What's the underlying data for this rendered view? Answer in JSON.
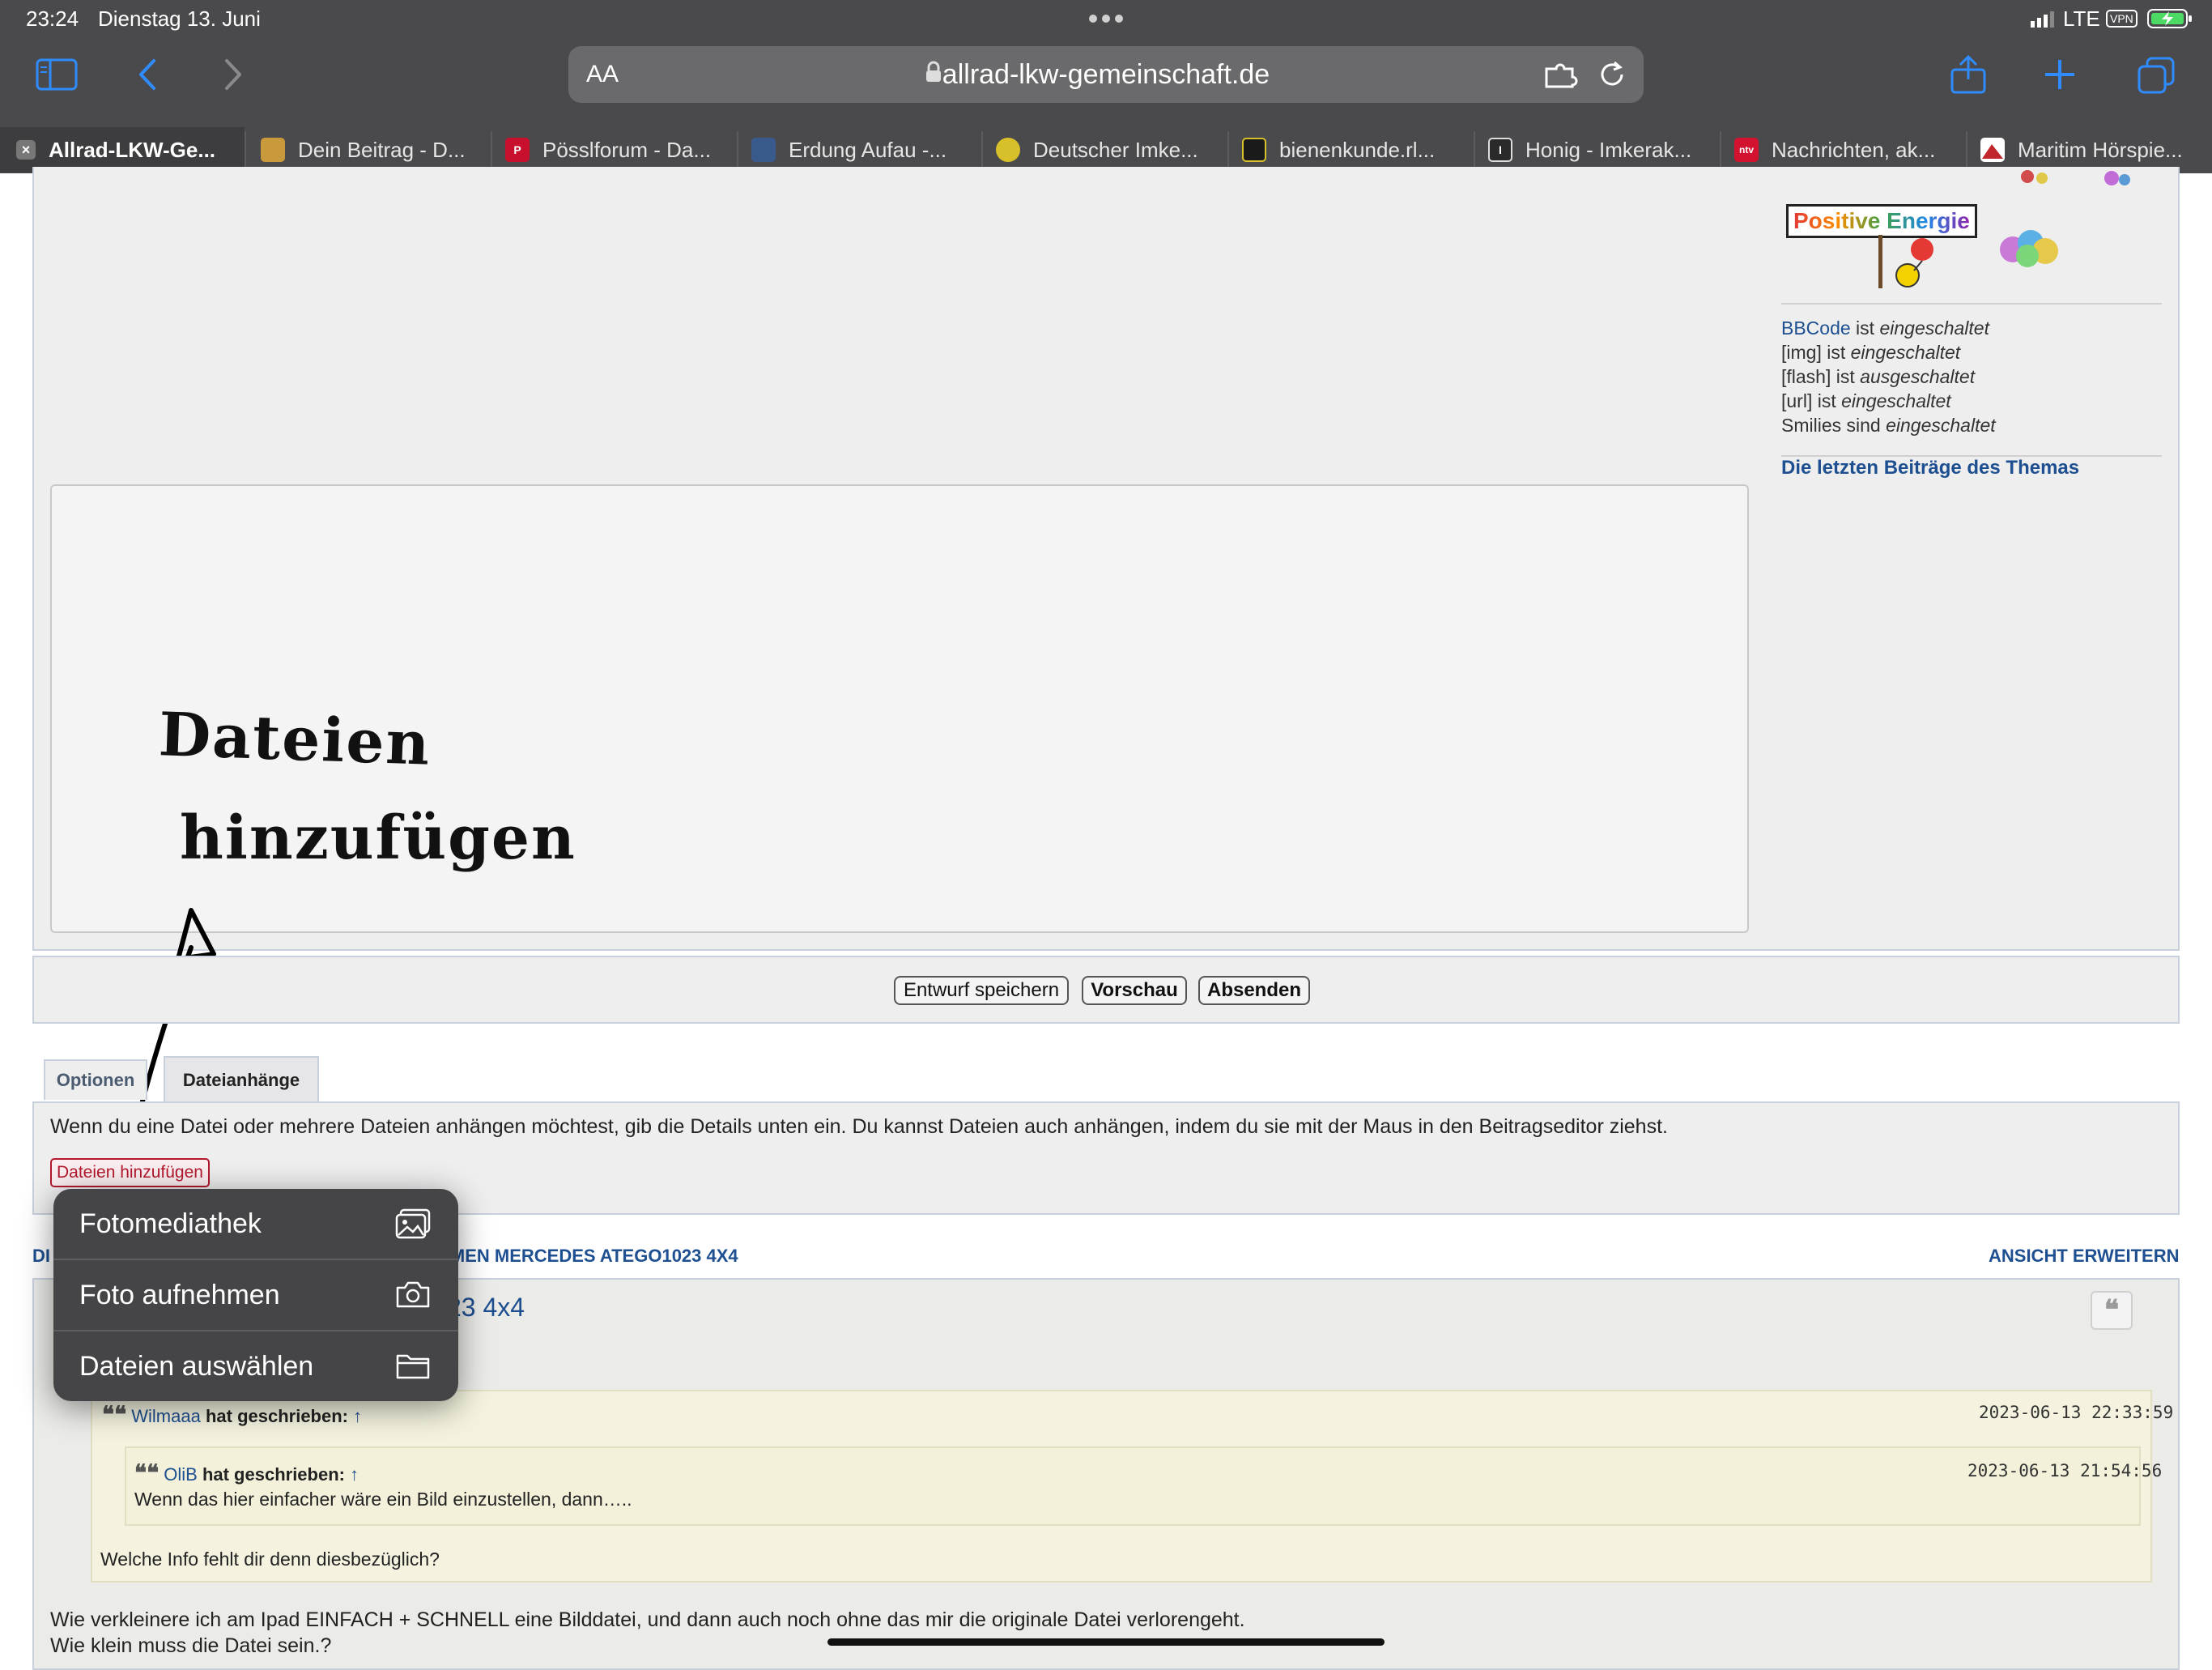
{
  "status": {
    "time": "23:24",
    "date": "Dienstag 13. Juni",
    "network": "LTE",
    "vpn": "VPN"
  },
  "toolbar": {
    "reader_label": "AA",
    "url": "allrad-lkw-gemeinschaft.de"
  },
  "tabs": [
    {
      "title": "Allrad-LKW-Ge...",
      "active": true,
      "favicon_color": "#8a8a8a"
    },
    {
      "title": "Dein Beitrag - D...",
      "favicon_color": "#c99a3b"
    },
    {
      "title": "Pösslforum - Da...",
      "favicon_color": "#c8102e",
      "favicon_letter": "P"
    },
    {
      "title": "Erdung Aufau -...",
      "favicon_color": "#3a5a8c"
    },
    {
      "title": "Deutscher Imke...",
      "favicon_color": "#d7c02a"
    },
    {
      "title": "bienenkunde.rl...",
      "favicon_color": "#1a1a1a"
    },
    {
      "title": "Honig - Imkerak...",
      "favicon_color": "#2a2a2a",
      "favicon_letter": "I"
    },
    {
      "title": "Nachrichten, ak...",
      "favicon_color": "#d2122e",
      "favicon_letter": "ntv"
    },
    {
      "title": "Maritim Hörspie...",
      "favicon_color": "#c0262c"
    }
  ],
  "sidebar": {
    "banner_text": "Positive Energie",
    "bbcode_lines": [
      {
        "prefix": "BBCode",
        "rest": " ist ",
        "state": "eingeschaltet",
        "link": true
      },
      {
        "prefix": "[img]",
        "rest": " ist ",
        "state": "eingeschaltet"
      },
      {
        "prefix": "[flash]",
        "rest": " ist ",
        "state": "ausgeschaltet"
      },
      {
        "prefix": "[url]",
        "rest": " ist ",
        "state": "eingeschaltet"
      },
      {
        "prefix": "Smilies",
        "rest": " sind ",
        "state": "eingeschaltet"
      }
    ],
    "latest_posts_link": "Die letzten Beiträge des Themas"
  },
  "handwriting": {
    "line1": "Dateien",
    "line2": "hinzufügen"
  },
  "actions": {
    "draft": "Entwurf speichern",
    "preview": "Vorschau",
    "submit": "Absenden"
  },
  "option_tabs": {
    "options": "Optionen",
    "attachments": "Dateianhänge"
  },
  "attachments": {
    "description": "Wenn du eine Datei oder mehrere Dateien anhängen möchtest, gib die Details unten ein. Du kannst Dateien auch anhängen, indem du sie mit der Maus in den Beitragseditor ziehst.",
    "add_button": "Dateien hinzufügen"
  },
  "popup_menu": {
    "items": [
      {
        "label": "Fotomediathek",
        "icon": "photo-library-icon"
      },
      {
        "label": "Foto aufnehmen",
        "icon": "camera-icon"
      },
      {
        "label": "Dateien auswählen",
        "icon": "folder-icon"
      }
    ]
  },
  "topic": {
    "breadcrumb_prefix": "DI",
    "breadcrumb_visible": "HMEN MERCEDES ATEGO1023 4X4",
    "expand_link": "ANSICHT ERWEITERN",
    "title_fragment": "23 4x4"
  },
  "quotes": {
    "outer_author": "Wilmaaa",
    "outer_suffix": " hat geschrieben:",
    "outer_arrow": "↑",
    "outer_time": "2023-06-13 22:33:59",
    "inner_author": "OliB",
    "inner_suffix": " hat geschrieben:",
    "inner_arrow": "↑",
    "inner_time": "2023-06-13 21:54:56",
    "inner_text": "Wenn das hier einfacher wäre ein Bild einzustellen, dann…..",
    "outer_text": "Welche Info fehlt dir denn diesbezüglich?"
  },
  "post_body": {
    "line1": "Wie verkleinere ich am Ipad EINFACH + SCHNELL eine Bilddatei, und dann auch noch ohne das mir die originale Datei verlorengeht.",
    "line2": "Wie klein muss die Datei sein.?"
  },
  "colors": {
    "chrome_bg": "#4a4a4c",
    "accent_blue": "#1d4f91",
    "system_blue": "#2f8cff",
    "attach_button_red": "#b3182d"
  }
}
